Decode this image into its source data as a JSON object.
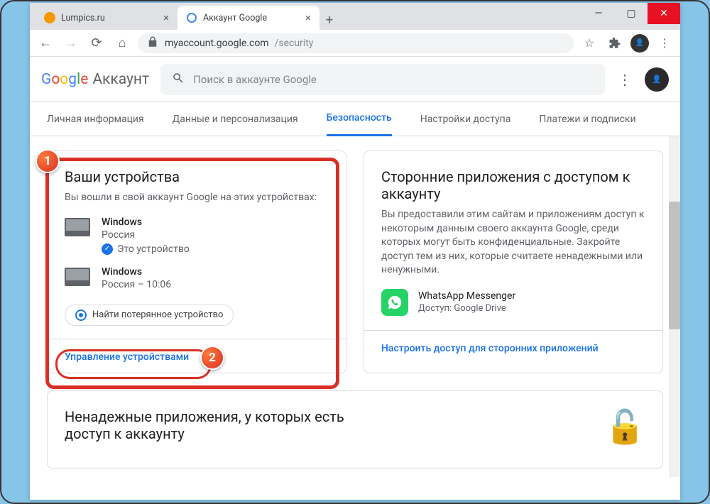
{
  "window": {
    "tabs": [
      {
        "title": "Lumpics.ru"
      },
      {
        "title": "Аккаунт Google"
      }
    ]
  },
  "address": {
    "domain": "myaccount.google.com",
    "path": "/security"
  },
  "app": {
    "logo_letters": [
      "G",
      "o",
      "o",
      "g",
      "l",
      "e"
    ],
    "logo_suffix": "Аккаунт",
    "search_placeholder": "Поиск в аккаунте Google"
  },
  "tabs": {
    "items": [
      "Личная информация",
      "Данные и персонализация",
      "Безопасность",
      "Настройки доступа",
      "Платежи и подписки"
    ],
    "active_index": 2
  },
  "card_devices": {
    "title": "Ваши устройства",
    "desc": "Вы вошли в свой аккаунт Google на этих устройствах:",
    "devices": [
      {
        "name": "Windows",
        "sub": "Россия",
        "this_label": "Это устройство"
      },
      {
        "name": "Windows",
        "sub": "Россия – 10:06"
      }
    ],
    "find_label": "Найти потерянное устройство",
    "manage_link": "Управление устройствами"
  },
  "card_apps": {
    "title": "Сторонние приложения с доступом к аккаунту",
    "desc": "Вы предоставили этим сайтам и приложениям доступ к некоторым данным своего аккаунта Google, среди которых могут быть конфиденциальные. Закройте доступ тем из них, которые считаете ненадежными или ненужными.",
    "app_name": "WhatsApp Messenger",
    "app_sub": "Доступ: Google Drive",
    "link": "Настроить доступ для сторонних приложений"
  },
  "card_low": {
    "title": "Ненадежные приложения, у которых есть доступ к аккаунту"
  },
  "badges": {
    "n1": "1",
    "n2": "2"
  }
}
